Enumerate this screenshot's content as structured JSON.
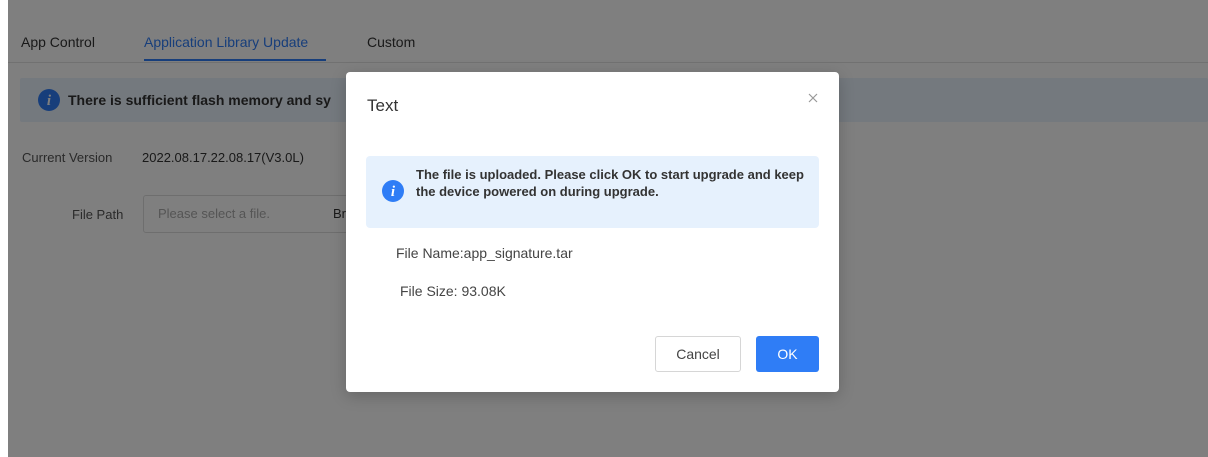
{
  "tabs": [
    {
      "label": "App Control",
      "active": false
    },
    {
      "label": "Application Library Update",
      "active": true
    },
    {
      "label": "Custom",
      "active": false
    }
  ],
  "notice": {
    "text": "There is sufficient flash memory and sy",
    "icon": "info-icon"
  },
  "current_version": {
    "label": "Current Version",
    "value": "2022.08.17.22.08.17(V3.0L)"
  },
  "file_path": {
    "label": "File Path",
    "placeholder": "Please select a file.",
    "browse_label": "Br"
  },
  "dialog": {
    "title": "Text",
    "alert_text": "The file is uploaded. Please click OK to start upgrade and keep the device powered on during upgrade.",
    "file_name": "File Name:app_signature.tar",
    "file_size": "File Size: 93.08K",
    "cancel_label": "Cancel",
    "ok_label": "OK"
  },
  "colors": {
    "accent": "#2f7df6",
    "alert_bg": "#e6f1fd",
    "overlay": "rgba(0,0,0,0.5)"
  }
}
